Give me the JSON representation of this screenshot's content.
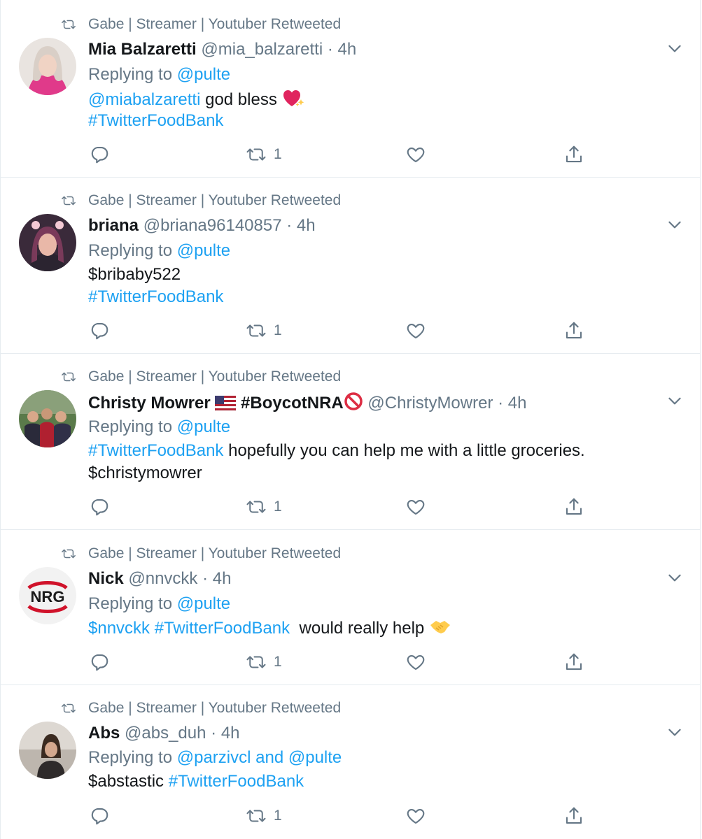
{
  "colors": {
    "accent": "#1da1f2",
    "muted": "#657786",
    "text": "#14171a",
    "border": "#e6ecf0"
  },
  "tweets": [
    {
      "context": "Gabe | Streamer | Youtuber Retweeted",
      "name": "Mia Balzaretti",
      "handle": "@mia_balzaretti",
      "sep": "·",
      "time": "4h",
      "reply_prefix": "Replying to",
      "reply_to": "@pulte",
      "line1": {
        "mention": "@miabalzaretti",
        "text": " god bless "
      },
      "line2": {
        "hashtag": "#TwitterFoodBank"
      },
      "retweets": "1",
      "emoji": "sparkling-heart"
    },
    {
      "context": "Gabe | Streamer | Youtuber Retweeted",
      "name": "briana",
      "handle": "@briana96140857",
      "sep": "·",
      "time": "4h",
      "reply_prefix": "Replying to",
      "reply_to": "@pulte",
      "line1": {
        "text": "$bribaby522"
      },
      "line2": {
        "hashtag": "#TwitterFoodBank"
      },
      "retweets": "1"
    },
    {
      "context": "Gabe | Streamer | Youtuber Retweeted",
      "name": "Christy Mowrer",
      "name_tag": "#BoycotNRA",
      "handle": "@ChristyMowrer",
      "sep": "·",
      "time": "4h",
      "reply_prefix": "Replying to",
      "reply_to": "@pulte",
      "line1": {
        "hashtag": "#TwitterFoodBank",
        "text": " hopefully you can help me with a little groceries."
      },
      "line2": {
        "text": "$christymowrer"
      },
      "retweets": "1",
      "emoji": "us-flag, prohibited"
    },
    {
      "context": "Gabe | Streamer | Youtuber Retweeted",
      "name": "Nick",
      "handle": "@nnvckk",
      "sep": "·",
      "time": "4h",
      "reply_prefix": "Replying to",
      "reply_to": "@pulte",
      "line1": {
        "cashtag": "$nnvckk",
        "hashtag": "#TwitterFoodBank",
        "text": "  would really help "
      },
      "avatar_logo": "NRG",
      "retweets": "1",
      "emoji": "handshake"
    },
    {
      "context": "Gabe | Streamer | Youtuber Retweeted",
      "name": "Abs",
      "handle": "@abs_duh",
      "sep": "·",
      "time": "4h",
      "reply_prefix": "Replying to",
      "reply_to_1": "@parzivcl",
      "reply_and": "and",
      "reply_to": "@pulte",
      "line1": {
        "text": "$abstastic ",
        "hashtag": "#TwitterFoodBank"
      },
      "retweets": "1"
    }
  ]
}
